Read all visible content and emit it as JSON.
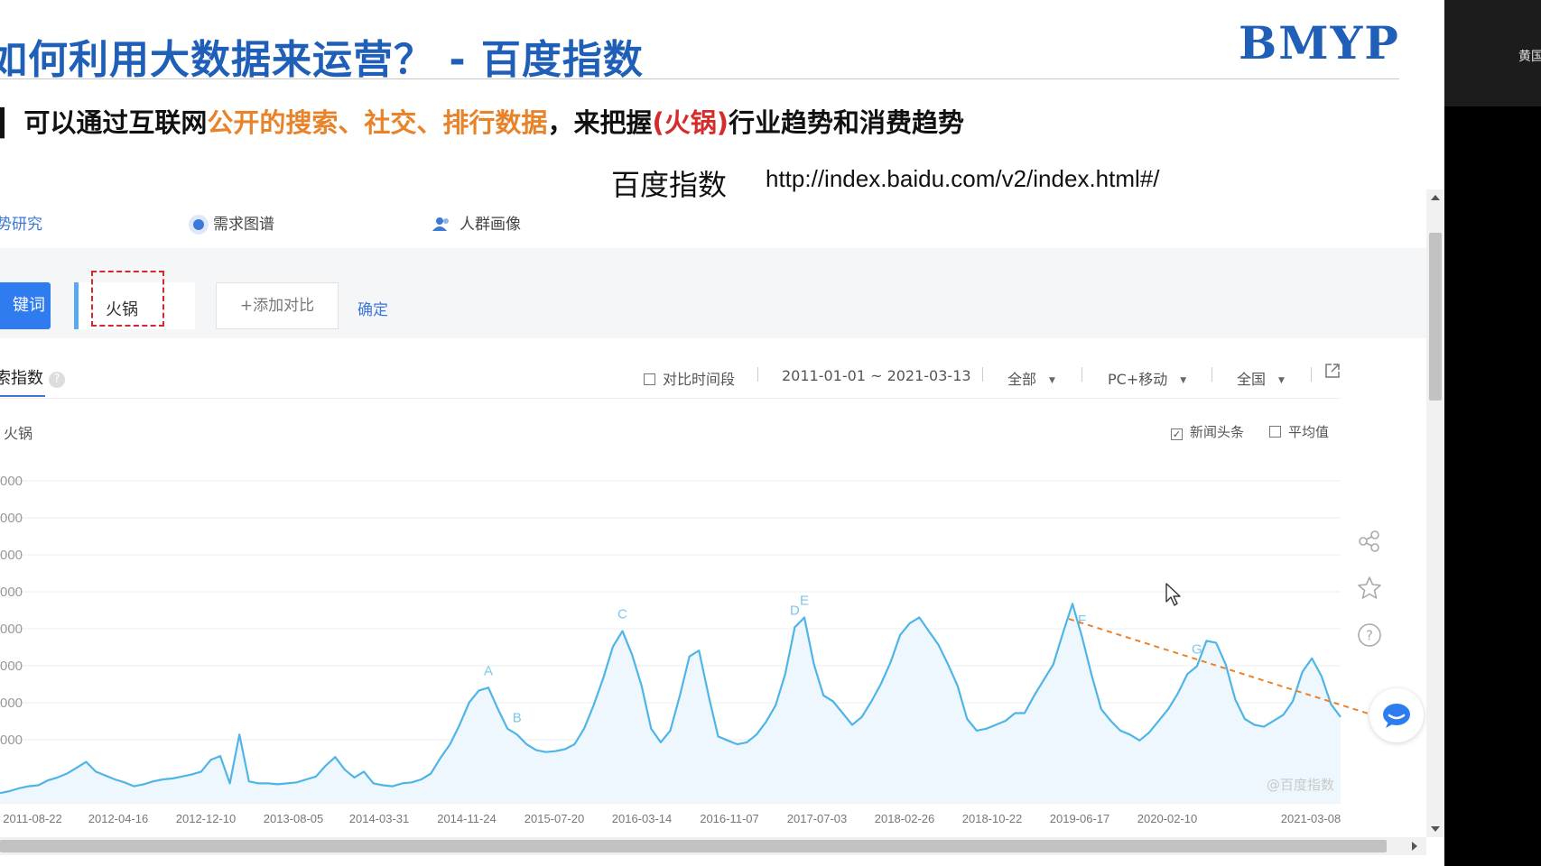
{
  "slide": {
    "title": "如何利用大数据来运营？ - 百度指数",
    "logo": "BMYP",
    "bullet": {
      "prefix": "可以通过互联网",
      "highlight": "公开的搜索、社交、排行数据",
      "middle": "，来把握",
      "red": "(火锅)",
      "suffix": "行业趋势和消费趋势"
    },
    "source_label": "百度指数",
    "source_url": "http://index.baidu.com/v2/index.html#/"
  },
  "page": {
    "nav": {
      "trend": "势研究",
      "demand": "需求图谱",
      "crowd": "人群画像"
    },
    "search": {
      "keyword_button": "键词",
      "keyword": "火锅",
      "add_compare": "+添加对比",
      "confirm": "确定"
    },
    "panel": {
      "title": "索指数",
      "compare_period": "对比时间段",
      "date_range": "2011-01-01 ~ 2021-03-13",
      "source_filter": "全部",
      "device_filter": "PC+移动",
      "region_filter": "全国",
      "legend_keyword": "火锅",
      "news_label": "新闻头条",
      "news_checked": true,
      "avg_label": "平均值",
      "avg_checked": false,
      "watermark": "@百度指数"
    }
  },
  "colors": {
    "accent": "#3c78d8",
    "series": "#4fb5e6",
    "trend_arrow": "#e8832a",
    "title": "#1f5fb8"
  },
  "chart_data": {
    "type": "line",
    "series": [
      {
        "name": "火锅",
        "values": [
          10,
          12,
          15,
          17,
          18,
          23,
          26,
          30,
          36,
          42,
          32,
          28,
          24,
          21,
          17,
          19,
          22,
          24,
          25,
          27,
          29,
          32,
          44,
          48,
          20,
          70,
          22,
          20,
          20,
          19,
          20,
          21,
          24,
          27,
          38,
          47,
          34,
          26,
          32,
          20,
          18,
          17,
          20,
          21,
          24,
          30,
          46,
          60,
          80,
          103,
          115,
          118,
          96,
          76,
          70,
          60,
          54,
          52,
          53,
          55,
          60,
          76,
          100,
          128,
          160,
          176,
          152,
          120,
          76,
          62,
          74,
          110,
          150,
          156,
          110,
          68,
          64,
          60,
          62,
          70,
          83,
          100,
          132,
          180,
          190,
          142,
          110,
          104,
          92,
          80,
          88,
          104,
          122,
          144,
          172,
          184,
          190,
          176,
          162,
          142,
          120,
          86,
          74,
          76,
          80,
          84,
          92,
          92,
          110,
          126,
          142,
          174,
          204,
          170,
          131,
          96,
          84,
          74,
          70,
          64,
          72,
          84,
          96,
          112,
          132,
          140,
          166,
          164,
          142,
          106,
          86,
          80,
          78,
          84,
          90,
          104,
          134,
          148,
          130,
          101,
          88
        ]
      }
    ],
    "y_ticks": [
      "000",
      "000",
      "000",
      "000",
      "000",
      "000",
      "000",
      "000"
    ],
    "ylim": [
      0,
      330
    ],
    "x_ticks": [
      "2011-08-22",
      "2012-04-16",
      "2012-12-10",
      "2013-08-05",
      "2014-03-31",
      "2014-11-24",
      "2015-07-20",
      "2016-03-14",
      "2016-11-07",
      "2017-07-03",
      "2018-02-26",
      "2018-10-22",
      "2019-06-17",
      "2020-02-10",
      "2021-03-08"
    ],
    "annotations": [
      {
        "label": "A",
        "index": 51
      },
      {
        "label": "B",
        "index": 54
      },
      {
        "label": "C",
        "index": 65
      },
      {
        "label": "D",
        "index": 83
      },
      {
        "label": "E",
        "index": 84
      },
      {
        "label": "F",
        "index": 113
      },
      {
        "label": "G",
        "index": 125
      }
    ],
    "trend_line": {
      "from_index": 112,
      "to_index": 147
    },
    "grid": true,
    "area_fill": true
  }
}
